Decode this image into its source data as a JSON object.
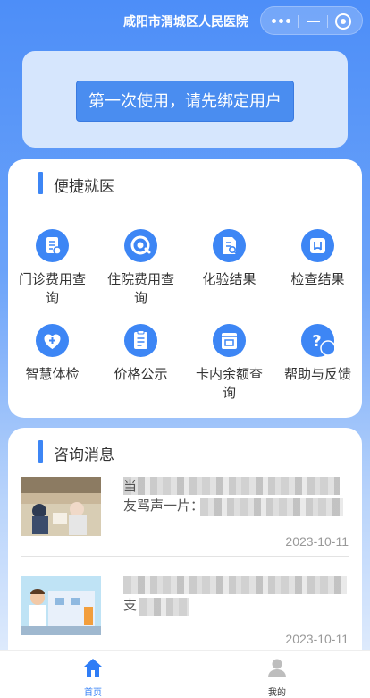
{
  "app": {
    "title": "咸阳市渭城区人民医院"
  },
  "bind": {
    "button_label": "第一次使用，请先绑定用户"
  },
  "quick": {
    "title": "便捷就医",
    "items": [
      {
        "label": "门诊费用查询",
        "icon": "outpatient-fee-icon"
      },
      {
        "label": "住院费用查询",
        "icon": "inpatient-fee-icon"
      },
      {
        "label": "化验结果",
        "icon": "lab-result-icon"
      },
      {
        "label": "检查结果",
        "icon": "exam-result-icon"
      },
      {
        "label": "智慧体检",
        "icon": "health-check-icon"
      },
      {
        "label": "价格公示",
        "icon": "price-list-icon"
      },
      {
        "label": "卡内余额查询",
        "icon": "card-balance-icon"
      },
      {
        "label": "帮助与反馈",
        "icon": "help-feedback-icon"
      }
    ]
  },
  "news": {
    "title": "咨询消息",
    "items": [
      {
        "title_fragment": "当",
        "title_fragment2": "友骂声一片：",
        "date": "2023-10-11"
      },
      {
        "title_fragment": "",
        "title_fragment2": "支",
        "date": "2023-10-11"
      }
    ]
  },
  "tabs": [
    {
      "label": "首页",
      "icon": "home-icon",
      "color": "#2f7df6"
    },
    {
      "label": "我的",
      "icon": "user-icon",
      "color": "#333333"
    }
  ],
  "colors": {
    "accent": "#3d86f5",
    "background_top": "#4d8ef8"
  }
}
